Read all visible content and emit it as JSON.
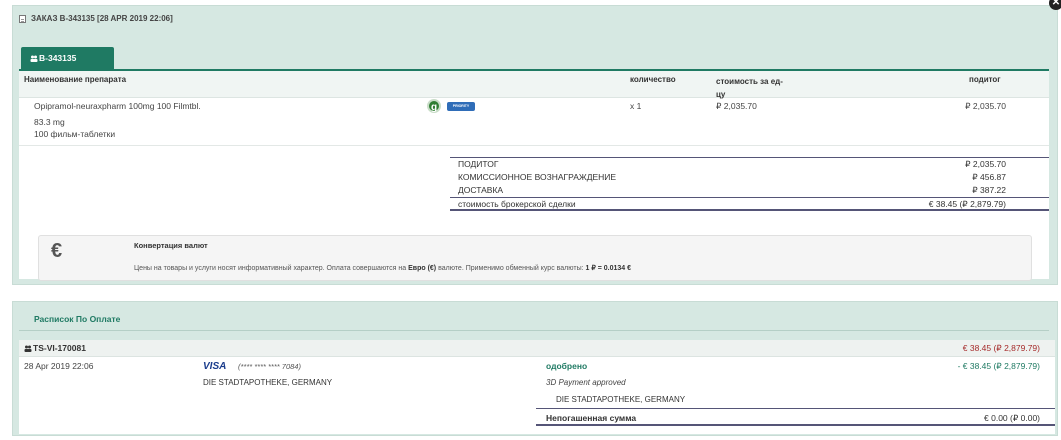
{
  "order": {
    "header": "ЗАКАЗ B-343135  [28 APR 2019 22:06]",
    "tab_label": "B-343135"
  },
  "table": {
    "col_name": "Наименование препарата",
    "col_qty": "количество",
    "col_price": "стоимость за ед-цу",
    "col_subtotal": "подитог",
    "row": {
      "name": "Opipramol-neuraxpharm 100mg 100 Filmtbl.",
      "dose": "83.3 mg",
      "form": "100  фильм-таблетки",
      "generic_badge": "g",
      "priority_badge": "PRIORITY",
      "qty": "x 1",
      "price": "₽ 2,035.70",
      "subtotal": "₽ 2,035.70"
    }
  },
  "summary": {
    "subtotal_label": "ПОДИТОГ",
    "subtotal_value": "₽ 2,035.70",
    "commission_label": "КОМИССИОННОЕ ВОЗНАГРАЖДЕНИЕ",
    "commission_value": "₽ 456.87",
    "delivery_label": "ДОСТАВКА",
    "delivery_value": "₽ 387.22",
    "total_label": "стоимость брокерской сделки",
    "total_value": "€ 38.45 (₽ 2,879.79)"
  },
  "conversion": {
    "icon": "€",
    "title": "Конвертация валют",
    "text_before": "Цены на товары и услуги носят информативный характер. Оплата совершаются на ",
    "currency": "Евро (€)",
    "text_middle": " валюте. Применимо обменный курс валюты: ",
    "rate": "1 ₽ = 0.0134 €"
  },
  "payments": {
    "title": "Расписок По Оплате",
    "transaction_id": "TS-VI-170081",
    "transaction_amount": "€ 38.45 (₽ 2,879.79)",
    "date": "28 Apr 2019 22:06",
    "card_brand": "VISA",
    "card_masked": "(**** **** **** 7084)",
    "merchant": "DIE STADTAPOTHEKE, GERMANY",
    "status": "одобрено",
    "refund_amount": "- € 38.45 (₽ 2,879.79)",
    "secure_note": "3D Payment approved",
    "merchant2": "DIE STADTAPOTHEKE, GERMANY",
    "unpaid_label": "Непогашенная сумма",
    "unpaid_value": "€ 0.00 (₽ 0.00)"
  },
  "colors": {
    "accent": "#1f7a63",
    "panel_bg": "#d6e8e2",
    "visa": "#1a3c8c",
    "amount_red": "#a52a2a"
  },
  "icons": {
    "header_icon": "document-icon",
    "tab_icon": "users-icon",
    "close_icon": "close-icon",
    "currency_icon": "euro-icon"
  }
}
